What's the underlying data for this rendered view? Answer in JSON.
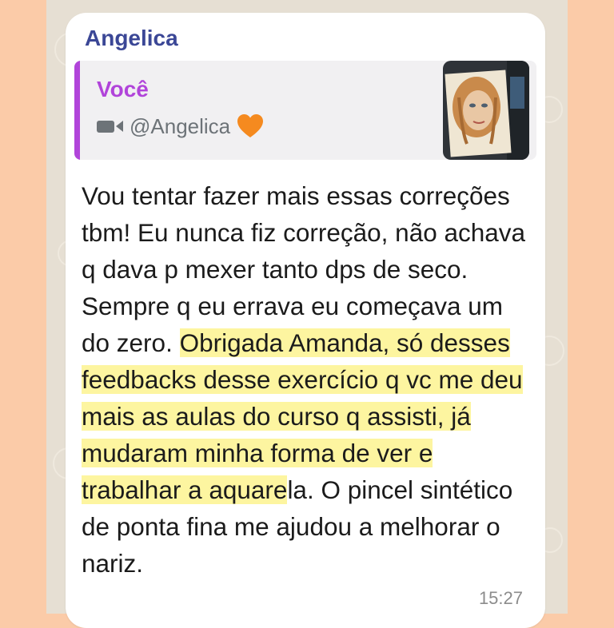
{
  "chat": {
    "sender_name": "Angelica",
    "reply": {
      "author": "Você",
      "media_icon": "video-camera-icon",
      "caption": "@Angelica",
      "emoji": "orange-heart",
      "thumbnail": "watercolor-portrait-thumbnail"
    },
    "message": {
      "before_highlight": "Vou tentar fazer mais essas correções tbm! Eu nunca fiz correção, não achava q dava p mexer tanto dps de seco. Sempre q eu errava eu começava um do zero. ",
      "highlight": "Obrigada Amanda, só desses feedbacks desse exercício q vc me deu mais as aulas do curso q assisti, já mudaram minha forma de ver e trabalhar a aquare",
      "after_highlight": "la. O pincel sintético de ponta fina me ajudou a melhorar o nariz."
    },
    "timestamp": "15:27"
  },
  "colors": {
    "page_background": "#FBCBA8",
    "chat_background": "#E6DFD3",
    "sender_name": "#3B4796",
    "reply_accent": "#B144DA",
    "highlight": "#FDF5A0"
  }
}
